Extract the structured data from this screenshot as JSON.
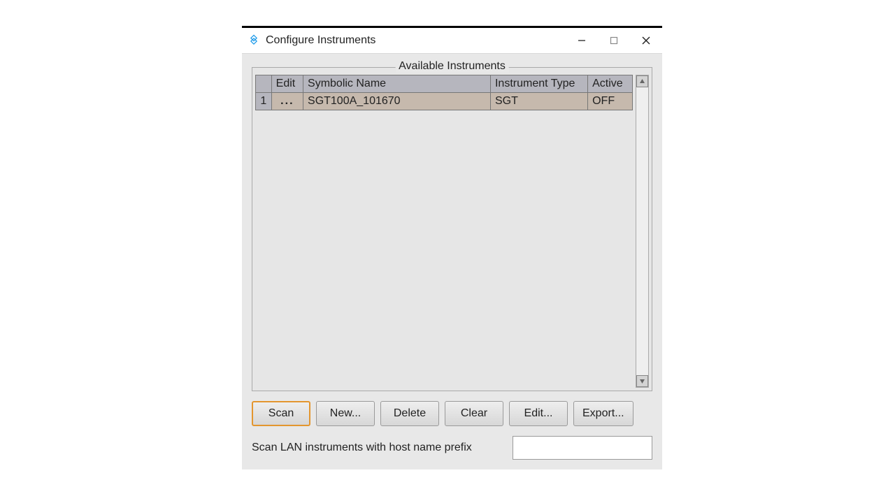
{
  "window": {
    "title": "Configure Instruments"
  },
  "fieldset": {
    "legend": "Available Instruments"
  },
  "table": {
    "headers": {
      "edit": "Edit",
      "name": "Symbolic Name",
      "type": "Instrument Type",
      "active": "Active"
    },
    "rows": [
      {
        "rownum": "1",
        "edit": "...",
        "name": "SGT100A_101670",
        "type": "SGT",
        "active": "OFF"
      }
    ]
  },
  "buttons": {
    "scan": "Scan",
    "new": "New...",
    "delete": "Delete",
    "clear": "Clear",
    "edit": "Edit...",
    "export": "Export..."
  },
  "scan": {
    "label": "Scan LAN instruments with host name prefix",
    "value": ""
  }
}
